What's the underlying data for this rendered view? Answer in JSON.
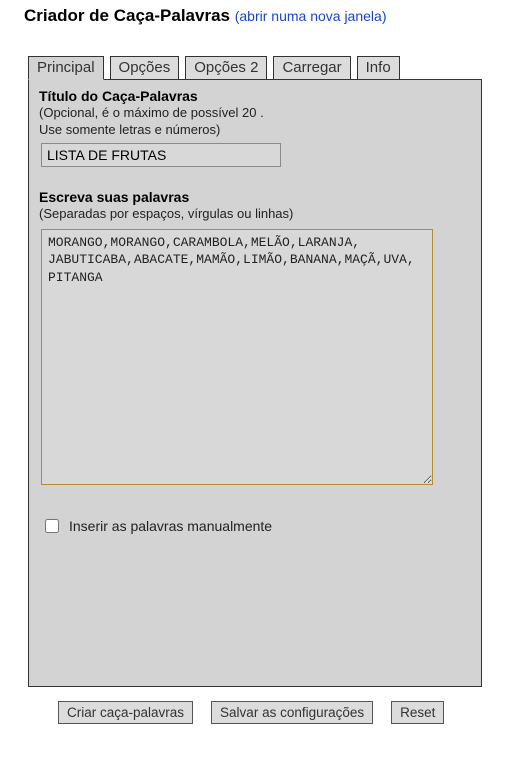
{
  "header": {
    "title": "Criador de Caça-Palavras",
    "link_text": "(abrir numa nova janela)"
  },
  "tabs": {
    "items": [
      {
        "label": "Principal",
        "active": true
      },
      {
        "label": "Opções",
        "active": false
      },
      {
        "label": "Opções 2",
        "active": false
      },
      {
        "label": "Carregar",
        "active": false
      },
      {
        "label": "Info",
        "active": false
      }
    ]
  },
  "title_section": {
    "label": "Título do Caça-Palavras",
    "hint": "(Opcional, é o máximo de possível 20 .\nUse somente letras e números)",
    "value": "LISTA DE FRUTAS"
  },
  "words_section": {
    "label": "Escreva suas palavras",
    "hint": "(Separadas por espaços, vírgulas ou linhas)",
    "value": "MORANGO,MORANGO,CARAMBOLA,MELÃO,LARANJA,\nJABUTICABA,ABACATE,MAMÃO,LIMÃO,BANANA,MAÇÃ,UVA,\nPITANGA"
  },
  "manual_checkbox": {
    "label": "Inserir as palavras manualmente",
    "checked": false
  },
  "buttons": {
    "create": "Criar caça-palavras",
    "save": "Salvar as configurações",
    "reset": "Reset"
  }
}
